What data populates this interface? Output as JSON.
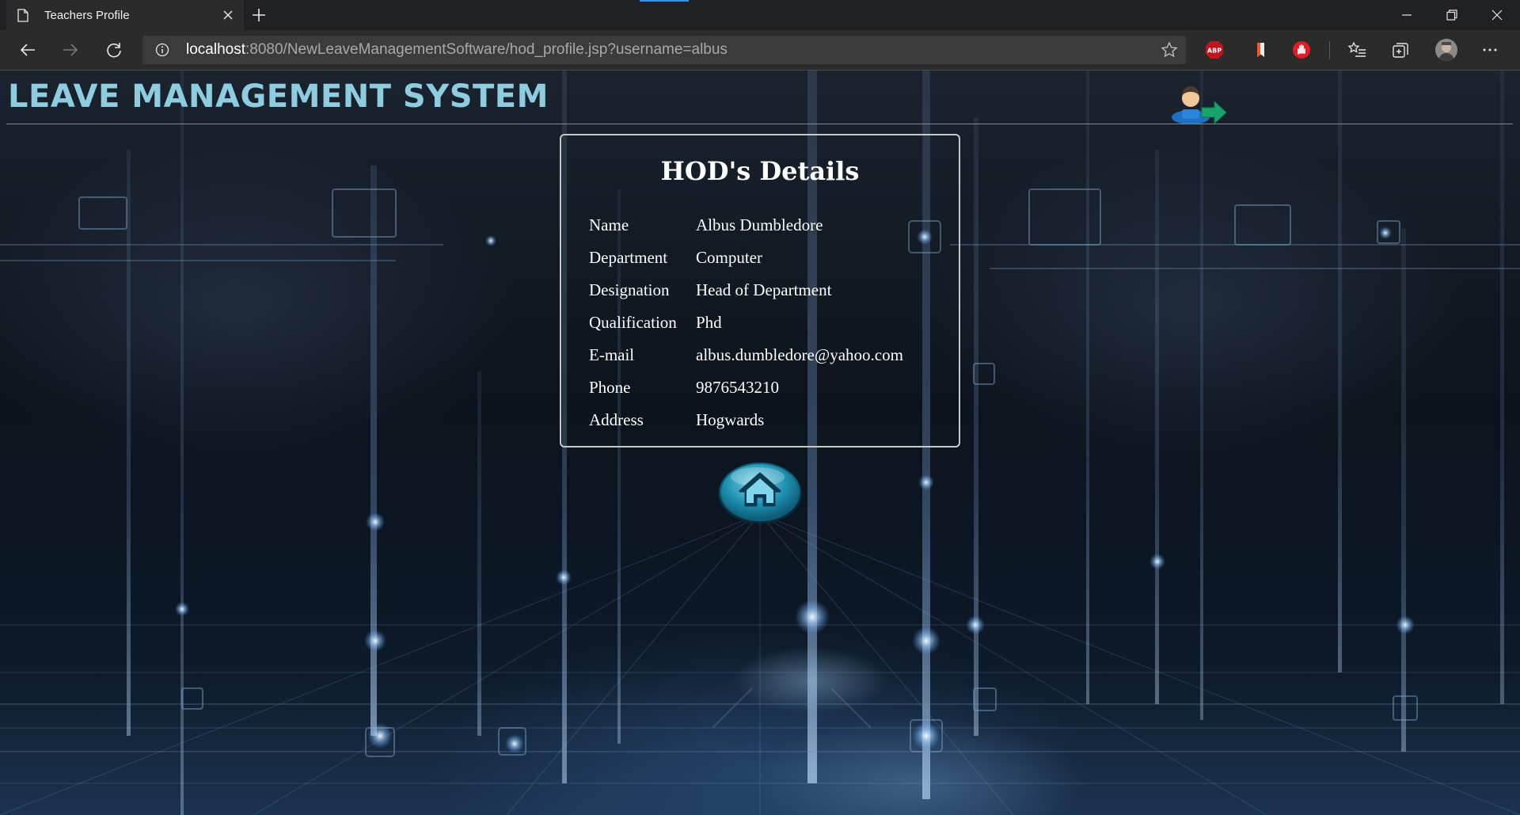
{
  "browser": {
    "tab_title": "Teachers Profile",
    "url_host": "localhost",
    "url_rest": ":8080/NewLeaveManagementSoftware/hod_profile.jsp?username=albus",
    "extensions": [
      "ABP"
    ]
  },
  "site": {
    "title": "LEAVE MANAGEMENT SYSTEM"
  },
  "details": {
    "heading": "HOD's Details",
    "rows": [
      {
        "label": "Name",
        "value": "Albus Dumbledore"
      },
      {
        "label": "Department",
        "value": "Computer"
      },
      {
        "label": "Designation",
        "value": "Head of Department"
      },
      {
        "label": "Qualification",
        "value": "Phd"
      },
      {
        "label": "E-mail",
        "value": "albus.dumbledore@yahoo.com"
      },
      {
        "label": "Phone",
        "value": "9876543210"
      },
      {
        "label": "Address",
        "value": "Hogwards"
      }
    ]
  },
  "colors": {
    "title": "#8ecde0",
    "home_button": "#1e8fb0",
    "logout_arrow": "#1aa36b"
  },
  "icons": [
    "document-icon",
    "close-icon",
    "plus-icon",
    "minimize-icon",
    "restore-icon",
    "back-arrow-icon",
    "forward-arrow-icon",
    "refresh-icon",
    "info-icon",
    "star-icon",
    "adblock-icon",
    "bookmark-extension-icon",
    "stop-hand-icon",
    "favorites-icon",
    "collections-icon",
    "profile-avatar",
    "more-icon",
    "logout-icon",
    "home-icon"
  ]
}
